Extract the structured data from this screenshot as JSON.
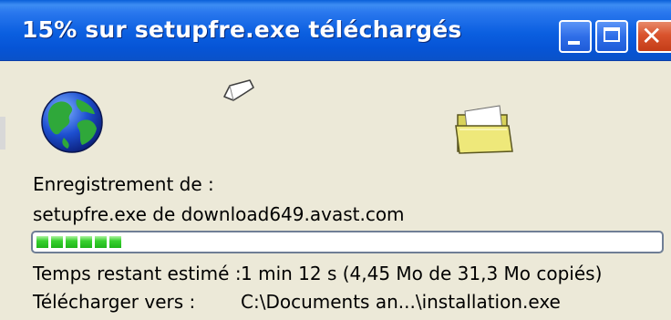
{
  "window": {
    "title": "15% sur setupfre.exe téléchargés",
    "buttons": {
      "minimize": "minimize",
      "maximize": "maximize",
      "close": "close"
    }
  },
  "download": {
    "saving_label": "Enregistrement de :",
    "source": "setupfre.exe de download649.avast.com",
    "progress_fraction": 0.15,
    "time_row": {
      "label": "Temps restant estimé :",
      "value": "1 min 12 s (4,45 Mo de 31,3 Mo copiés)"
    },
    "dest_row": {
      "label": "Télécharger vers :",
      "value": "C:\\Documents an...\\installation.exe"
    }
  },
  "icons": {
    "globe": "globe-icon",
    "flying_page": "flying-document-icon",
    "folder": "open-folder-icon"
  },
  "colors": {
    "titlebar": "#0b5fe0",
    "window_bg": "#ece9d8",
    "progress_segment": "#38d12f",
    "close_button": "#d9532d"
  }
}
